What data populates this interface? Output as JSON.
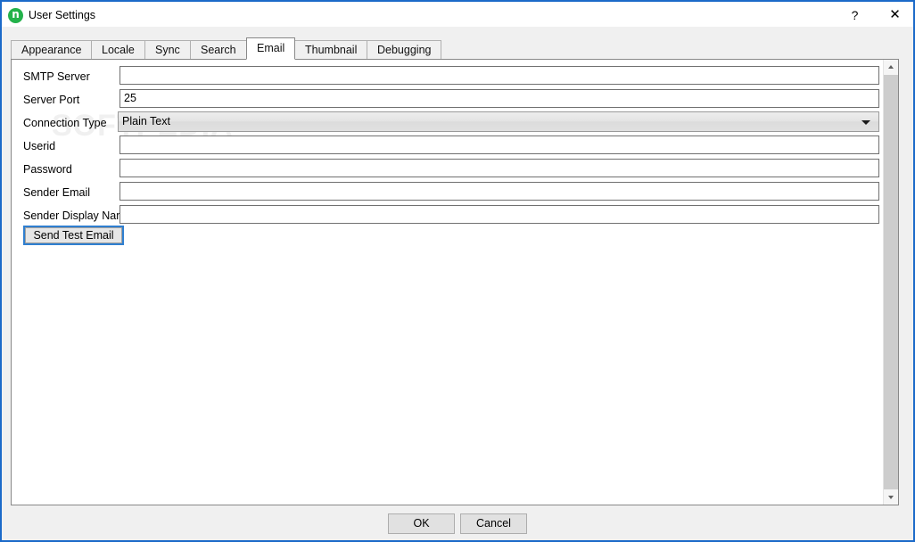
{
  "window": {
    "title": "User Settings",
    "app_icon": "nextcloud-n-icon",
    "accent_color": "#1b6ac9",
    "help_label": "?",
    "close_label": "✕"
  },
  "tabs": [
    {
      "label": "Appearance",
      "selected": false
    },
    {
      "label": "Locale",
      "selected": false
    },
    {
      "label": "Sync",
      "selected": false
    },
    {
      "label": "Search",
      "selected": false
    },
    {
      "label": "Email",
      "selected": true
    },
    {
      "label": "Thumbnail",
      "selected": false
    },
    {
      "label": "Debugging",
      "selected": false
    }
  ],
  "form": {
    "fields": [
      {
        "label": "SMTP Server",
        "value": "",
        "type": "text"
      },
      {
        "label": "Server Port",
        "value": "25",
        "type": "text"
      },
      {
        "label": "Connection Type",
        "value": "Plain Text",
        "type": "combo"
      },
      {
        "label": "Userid",
        "value": "",
        "type": "text"
      },
      {
        "label": "Password",
        "value": "",
        "type": "text"
      },
      {
        "label": "Sender Email",
        "value": "",
        "type": "text"
      },
      {
        "label": "Sender Display Name",
        "value": "",
        "type": "text"
      }
    ],
    "send_test_email_label": "Send Test Email"
  },
  "footer": {
    "ok_label": "OK",
    "cancel_label": "Cancel"
  },
  "watermark": {
    "text": "SOFTPEDIA",
    "mark": "®"
  }
}
